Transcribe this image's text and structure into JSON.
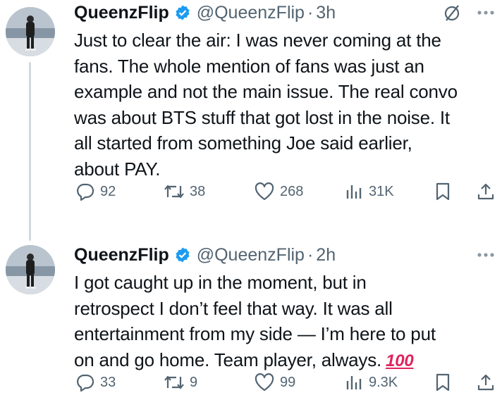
{
  "tweets": [
    {
      "display_name": "QueenzFlip",
      "handle": "@QueenzFlip",
      "separator": "·",
      "time": "3h",
      "text": "Just to clear the air: I was never coming at the\nfans. The whole mention of fans was just an\nexample and not the main issue. The real convo\nwas about BTS stuff that got lost in the noise. It\nall started from something Joe said earlier,\nabout PAY.",
      "emoji": "",
      "replies": "92",
      "reposts": "38",
      "likes": "268",
      "views": "31K"
    },
    {
      "display_name": "QueenzFlip",
      "handle": "@QueenzFlip",
      "separator": "·",
      "time": "2h",
      "text": "I got caught up in the moment, but in\nretrospect I don’t feel that way. It was all\nentertainment from my side — I’m here to put\non and go home. Team player, always.",
      "emoji": "100",
      "replies": "33",
      "reposts": "9",
      "likes": "99",
      "views": "9.3K"
    }
  ],
  "icons": {
    "verified": "verified-badge-icon",
    "grok": "slash-circle-icon",
    "more": "more-dots-icon",
    "reply": "reply-icon",
    "repost": "repost-icon",
    "like": "like-icon",
    "views": "views-icon",
    "bookmark": "bookmark-icon",
    "share": "share-icon"
  },
  "colors": {
    "verified": "#1d9bf0",
    "muted": "#536471",
    "text": "#0f1419",
    "emoji": "#e0245e"
  }
}
